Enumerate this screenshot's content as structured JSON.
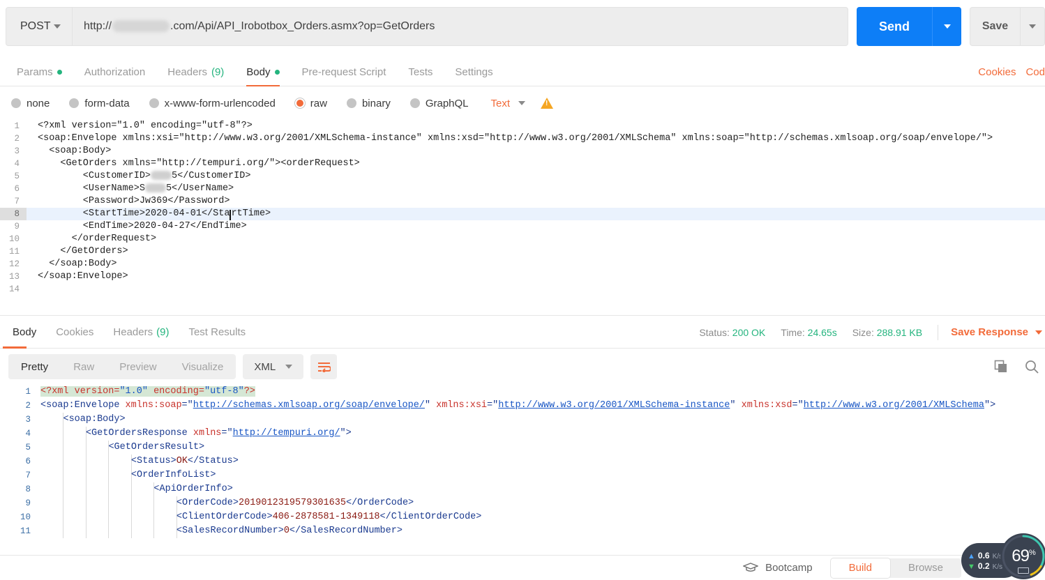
{
  "request": {
    "method": "POST",
    "url_prefix": "http://",
    "url_suffix": ".com/Api/API_Irobotbox_Orders.asmx?op=GetOrders",
    "send_label": "Send",
    "save_label": "Save",
    "tabs": [
      {
        "label": "Params",
        "marker": "dot",
        "active": false
      },
      {
        "label": "Authorization",
        "marker": "",
        "active": false
      },
      {
        "label": "Headers",
        "marker": "(9)",
        "active": false
      },
      {
        "label": "Body",
        "marker": "dot",
        "active": true
      },
      {
        "label": "Pre-request Script",
        "marker": "",
        "active": false
      },
      {
        "label": "Tests",
        "marker": "",
        "active": false
      },
      {
        "label": "Settings",
        "marker": "",
        "active": false
      }
    ],
    "links": [
      "Cookies",
      "Cod"
    ],
    "body_types": [
      {
        "label": "none",
        "selected": false
      },
      {
        "label": "form-data",
        "selected": false
      },
      {
        "label": "x-www-form-urlencoded",
        "selected": false
      },
      {
        "label": "raw",
        "selected": true
      },
      {
        "label": "binary",
        "selected": false
      },
      {
        "label": "GraphQL",
        "selected": false
      }
    ],
    "raw_format": "Text",
    "body_lines": [
      {
        "n": 1,
        "text": "<?xml version=\"1.0\" encoding=\"utf-8\"?>"
      },
      {
        "n": 2,
        "text": "<soap:Envelope xmlns:xsi=\"http://www.w3.org/2001/XMLSchema-instance\" xmlns:xsd=\"http://www.w3.org/2001/XMLSchema\" xmlns:soap=\"http://schemas.xmlsoap.org/soap/envelope/\">"
      },
      {
        "n": 3,
        "text": "  <soap:Body>"
      },
      {
        "n": 4,
        "text": "    <GetOrders xmlns=\"http://tempuri.org/\"><orderRequest>"
      },
      {
        "n": 5,
        "text": "        <CustomerID>██5</CustomerID>",
        "redacted": true
      },
      {
        "n": 6,
        "text": "        <UserName>S██5</UserName>",
        "redacted": true
      },
      {
        "n": 7,
        "text": "        <Password>Jw369</Password>"
      },
      {
        "n": 8,
        "text": "        <StartTime>2020-04-01</StartTime>",
        "active": true,
        "caret_after": 34
      },
      {
        "n": 9,
        "text": "        <EndTime>2020-04-27</EndTime>"
      },
      {
        "n": 10,
        "text": "      </orderRequest>"
      },
      {
        "n": 11,
        "text": "    </GetOrders>"
      },
      {
        "n": 12,
        "text": "  </soap:Body>"
      },
      {
        "n": 13,
        "text": "</soap:Envelope>"
      },
      {
        "n": 14,
        "text": ""
      }
    ]
  },
  "response": {
    "tabs": [
      {
        "label": "Body",
        "marker": "",
        "active": true
      },
      {
        "label": "Cookies",
        "marker": "",
        "active": false
      },
      {
        "label": "Headers",
        "marker": "(9)",
        "active": false
      },
      {
        "label": "Test Results",
        "marker": "",
        "active": false
      }
    ],
    "status_label": "Status:",
    "status_value": "200 OK",
    "time_label": "Time:",
    "time_value": "24.65s",
    "size_label": "Size:",
    "size_value": "288.91 KB",
    "save_response": "Save Response",
    "view_modes": [
      {
        "label": "Pretty",
        "active": true
      },
      {
        "label": "Raw",
        "active": false
      },
      {
        "label": "Preview",
        "active": false
      },
      {
        "label": "Visualize",
        "active": false
      }
    ],
    "format": "XML",
    "icons": {
      "wrap": "wrap-lines-icon",
      "copy": "copy-icon",
      "search": "search-icon"
    },
    "body_lines": [
      {
        "n": 1,
        "indent": 0,
        "parts": [
          {
            "t": "<?xml ",
            "c": "pi",
            "sel": true
          },
          {
            "t": "version",
            "c": "at",
            "sel": true
          },
          {
            "t": "=",
            "c": "pi",
            "sel": true
          },
          {
            "t": "\"1.0\"",
            "c": "qt",
            "sel": true
          },
          {
            "t": " ",
            "c": "pi",
            "sel": true
          },
          {
            "t": "encoding",
            "c": "at",
            "sel": true
          },
          {
            "t": "=",
            "c": "pi",
            "sel": true
          },
          {
            "t": "\"utf-8\"",
            "c": "qt",
            "sel": true
          },
          {
            "t": "?>",
            "c": "pi",
            "sel": true
          }
        ]
      },
      {
        "n": 2,
        "indent": 0,
        "parts": [
          {
            "t": "<soap:Envelope ",
            "c": "tg"
          },
          {
            "t": "xmlns:soap",
            "c": "at"
          },
          {
            "t": "=\"",
            "c": "tg"
          },
          {
            "t": "http://schemas.xmlsoap.org/soap/envelope/",
            "c": "av"
          },
          {
            "t": "\" ",
            "c": "tg"
          },
          {
            "t": "xmlns:xsi",
            "c": "at"
          },
          {
            "t": "=\"",
            "c": "tg"
          },
          {
            "t": "http://www.w3.org/2001/XMLSchema-instance",
            "c": "av"
          },
          {
            "t": "\" ",
            "c": "tg"
          },
          {
            "t": "xmlns:xsd",
            "c": "at"
          },
          {
            "t": "=\"",
            "c": "tg"
          },
          {
            "t": "http://www.w3.org/2001/XMLSchema",
            "c": "av"
          },
          {
            "t": "\">",
            "c": "tg"
          }
        ]
      },
      {
        "n": 3,
        "indent": 4,
        "parts": [
          {
            "t": "<soap:Body>",
            "c": "tg"
          }
        ]
      },
      {
        "n": 4,
        "indent": 8,
        "parts": [
          {
            "t": "<GetOrdersResponse ",
            "c": "tg"
          },
          {
            "t": "xmlns",
            "c": "at"
          },
          {
            "t": "=\"",
            "c": "tg"
          },
          {
            "t": "http://tempuri.org/",
            "c": "av"
          },
          {
            "t": "\">",
            "c": "tg"
          }
        ]
      },
      {
        "n": 5,
        "indent": 12,
        "parts": [
          {
            "t": "<GetOrdersResult>",
            "c": "tg"
          }
        ]
      },
      {
        "n": 6,
        "indent": 16,
        "parts": [
          {
            "t": "<Status>",
            "c": "tg"
          },
          {
            "t": "OK",
            "c": "txt"
          },
          {
            "t": "</Status>",
            "c": "tg"
          }
        ]
      },
      {
        "n": 7,
        "indent": 16,
        "parts": [
          {
            "t": "<OrderInfoList>",
            "c": "tg"
          }
        ]
      },
      {
        "n": 8,
        "indent": 20,
        "parts": [
          {
            "t": "<ApiOrderInfo>",
            "c": "tg"
          }
        ]
      },
      {
        "n": 9,
        "indent": 24,
        "parts": [
          {
            "t": "<OrderCode>",
            "c": "tg"
          },
          {
            "t": "2019012319579301635",
            "c": "txt"
          },
          {
            "t": "</OrderCode>",
            "c": "tg"
          }
        ]
      },
      {
        "n": 10,
        "indent": 24,
        "parts": [
          {
            "t": "<ClientOrderCode>",
            "c": "tg"
          },
          {
            "t": "406-2878581-1349118",
            "c": "txt"
          },
          {
            "t": "</ClientOrderCode>",
            "c": "tg"
          }
        ]
      },
      {
        "n": 11,
        "indent": 24,
        "parts": [
          {
            "t": "<SalesRecordNumber>",
            "c": "tg"
          },
          {
            "t": "0",
            "c": "txt"
          },
          {
            "t": "</SalesRecordNumber>",
            "c": "tg"
          }
        ]
      }
    ]
  },
  "bottom": {
    "bootcamp": "Bootcamp",
    "modes": [
      {
        "label": "Build",
        "active": true
      },
      {
        "label": "Browse",
        "active": false
      }
    ]
  },
  "monitor": {
    "upload": "0.6",
    "upload_unit": "K/s",
    "download": "0.2",
    "download_unit": "K/s",
    "percent": "69",
    "percent_unit": "%"
  },
  "colors": {
    "accent": "#f26b3a",
    "send_blue": "#0d7ef7",
    "green": "#24b47e",
    "warning": "#f5a623"
  }
}
